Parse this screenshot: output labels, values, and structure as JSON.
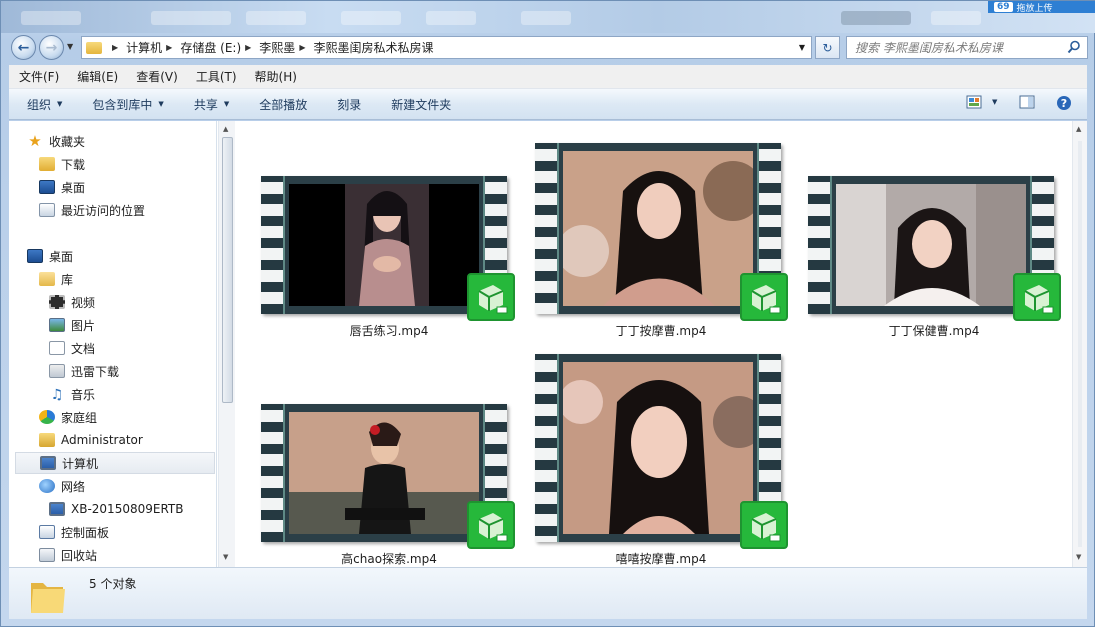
{
  "window": {
    "search_placeholder": "搜索 李熙墨闺房私术私房课",
    "brand_badge": {
      "number": "69",
      "text": "拖放上传"
    }
  },
  "address": {
    "crumbs": [
      "计算机",
      "存储盘 (E:)",
      "李熙墨",
      "李熙墨闺房私术私房课"
    ]
  },
  "menu": [
    "文件(F)",
    "编辑(E)",
    "查看(V)",
    "工具(T)",
    "帮助(H)"
  ],
  "toolbar": {
    "organize": "组织",
    "include_in_library": "包含到库中",
    "share": "共享",
    "play_all": "全部播放",
    "burn": "刻录",
    "new_folder": "新建文件夹"
  },
  "nav": {
    "favorites": "收藏夹",
    "downloads": "下载",
    "desktop_fav": "桌面",
    "recent": "最近访问的位置",
    "desktop": "桌面",
    "library": "库",
    "videos": "视频",
    "pictures": "图片",
    "documents": "文档",
    "xunlei": "迅雷下载",
    "music": "音乐",
    "homegroup": "家庭组",
    "administrator": "Administrator",
    "computer": "计算机",
    "network": "网络",
    "pc_name": "XB-20150809ERTB",
    "control_panel": "控制面板",
    "recycle_bin": "回收站"
  },
  "files": [
    {
      "name": "唇舌练习.mp4"
    },
    {
      "name": "丁丁按摩曹.mp4"
    },
    {
      "name": "丁丁保健曹.mp4"
    },
    {
      "name": "高chao探索.mp4"
    },
    {
      "name": "嘻嘻按摩曹.mp4"
    }
  ],
  "status": {
    "count_text": "5 个对象"
  },
  "colors": {
    "accent": "#2e7fd3",
    "badge_green": "#26b83b",
    "film_dark": "#2b3f47"
  }
}
